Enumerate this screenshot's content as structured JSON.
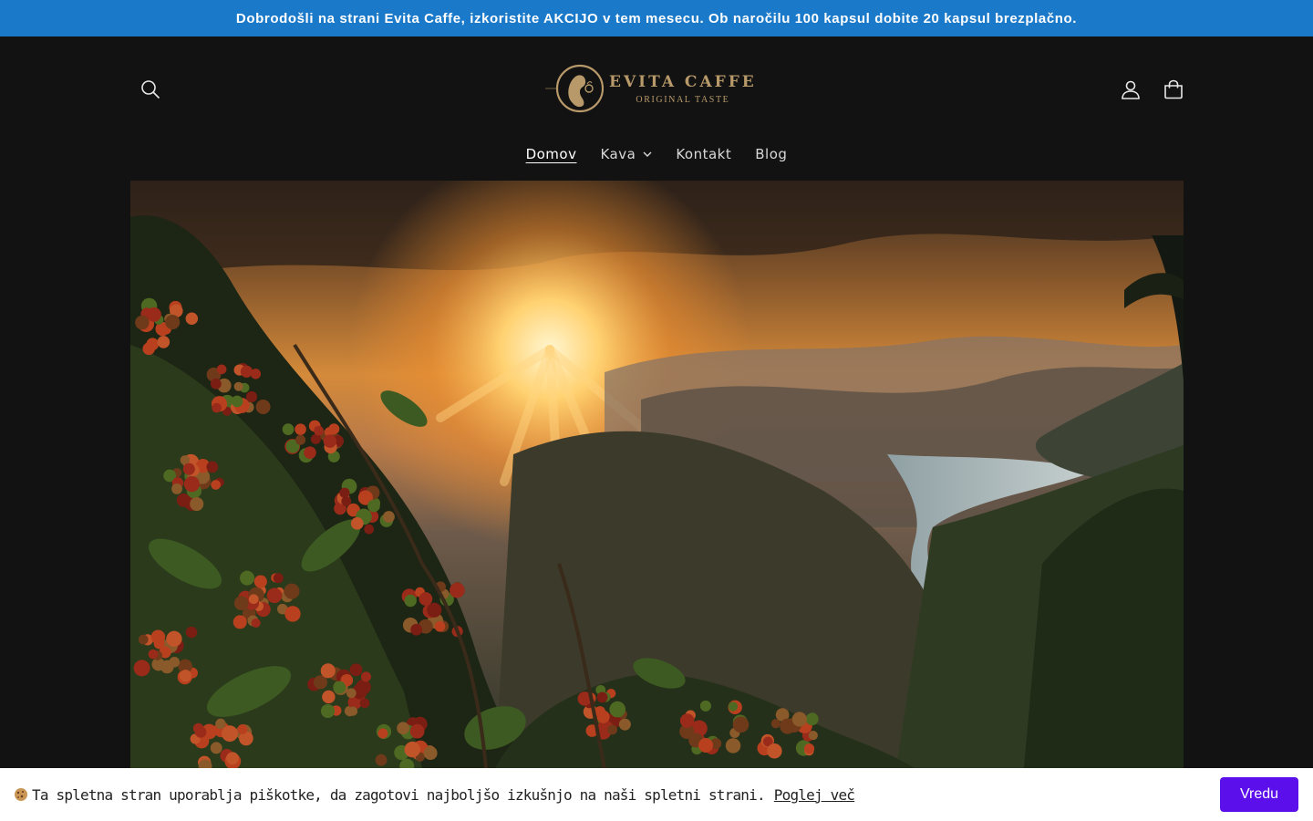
{
  "announcement": {
    "text": "Dobrodošli na strani Evita Caffe, izkoristite AKCIJO v tem mesecu. Ob naročilu 100 kapsul dobite 20 kapsul brezplačno."
  },
  "header": {
    "logo": {
      "name": "EVITA CAFFE",
      "tagline": "ORIGINAL TASTE"
    },
    "icons": {
      "search": "search-icon",
      "account": "account-icon",
      "cart": "cart-icon"
    }
  },
  "nav": {
    "items": [
      {
        "label": "Domov",
        "active": true
      },
      {
        "label": "Kava",
        "dropdown": true
      },
      {
        "label": "Kontakt"
      },
      {
        "label": "Blog"
      }
    ]
  },
  "hero": {
    "image": "coffee-plantation-sunset"
  },
  "cookie": {
    "text": "Ta spletna stran uporablja piškotke, da zagotovi najboljšo izkušnjo na naši spletni strani.",
    "link": "Poglej več",
    "button": "Vredu"
  },
  "colors": {
    "announcement_bg": "#1b79c9",
    "page_bg": "#121212",
    "logo_gold": "#b89a6a",
    "cookie_button": "#5b0fea"
  }
}
